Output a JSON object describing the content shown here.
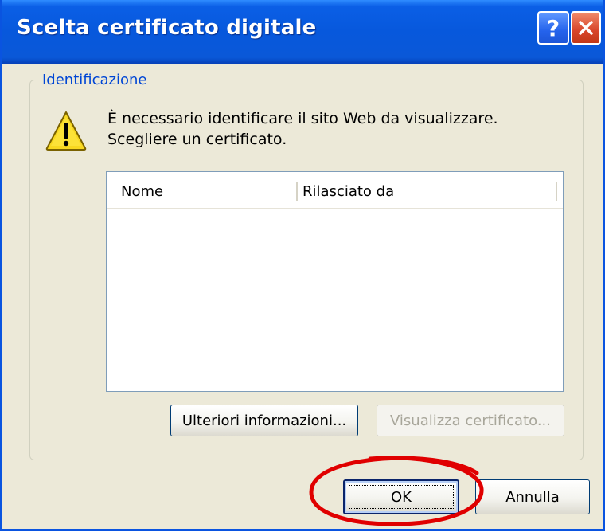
{
  "window": {
    "title": "Scelta certificato digitale",
    "help_icon": "help-icon",
    "close_icon": "close-icon"
  },
  "group": {
    "legend": "Identificazione",
    "message_line1": "È necessario identificare il sito Web da visualizzare.",
    "message_line2": "Scegliere un certificato.",
    "warning_icon": "warning-icon"
  },
  "certificate_list": {
    "columns": [
      "Nome",
      "Rilasciato da"
    ],
    "rows": []
  },
  "buttons": {
    "more_info": "Ulteriori informazioni...",
    "view_certificate": "Visualizza certificato...",
    "ok": "OK",
    "cancel": "Annulla"
  },
  "annotation": {
    "shape": "red-ellipse-highlight",
    "color": "#e00000"
  },
  "colors": {
    "titlebar": "#0a58d8",
    "dialog_bg": "#ece9d8",
    "legend_text": "#0046d5"
  }
}
